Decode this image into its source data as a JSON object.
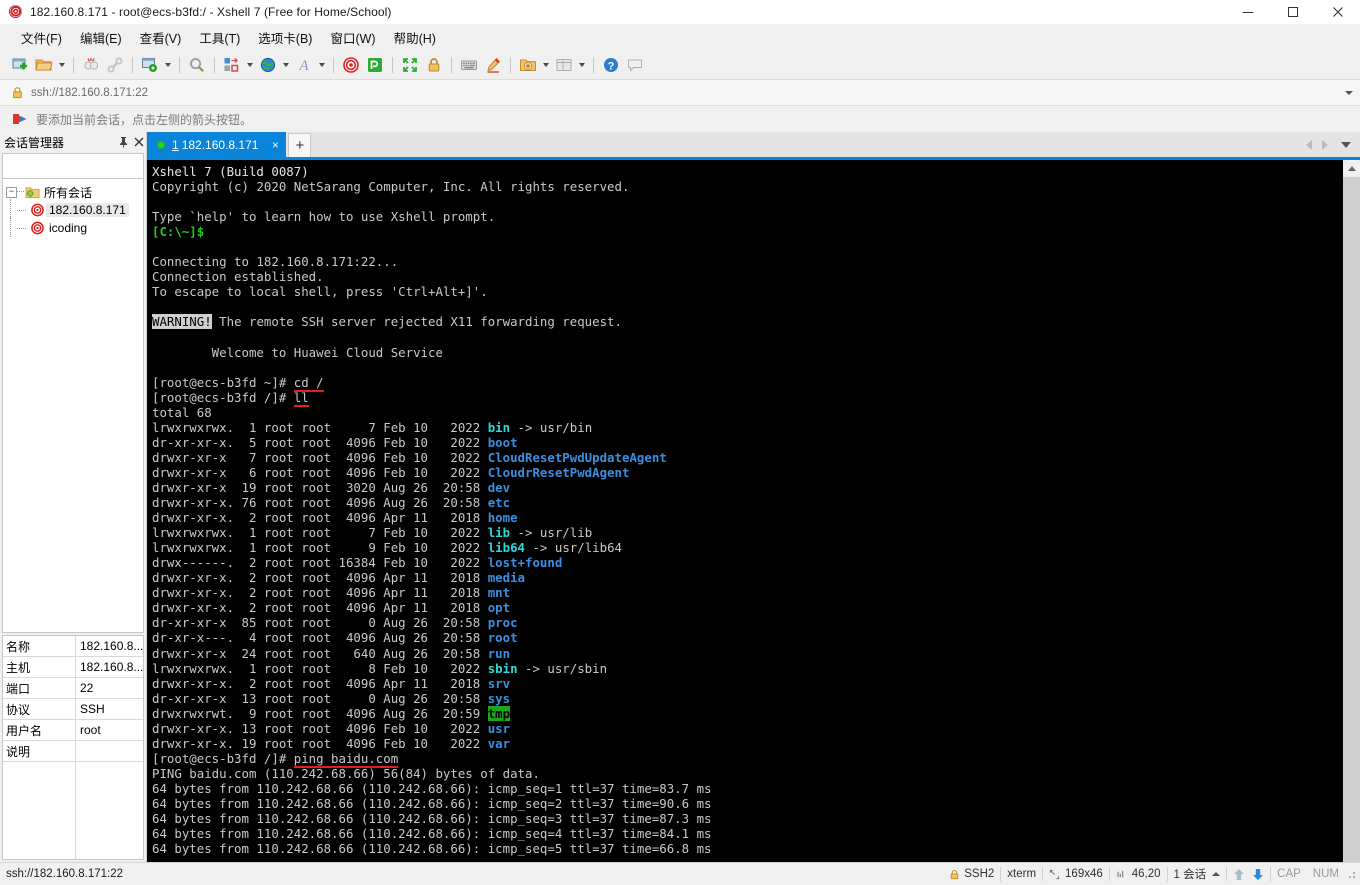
{
  "window": {
    "title": "182.160.8.171 - root@ecs-b3fd:/ - Xshell 7 (Free for Home/School)",
    "minimize": "minimize-button",
    "maximize": "maximize-button",
    "close": "close-button"
  },
  "menubar": [
    {
      "label": "文件(F)",
      "name": "menu-file"
    },
    {
      "label": "编辑(E)",
      "name": "menu-edit"
    },
    {
      "label": "查看(V)",
      "name": "menu-view"
    },
    {
      "label": "工具(T)",
      "name": "menu-tools"
    },
    {
      "label": "选项卡(B)",
      "name": "menu-tabs"
    },
    {
      "label": "窗口(W)",
      "name": "menu-window"
    },
    {
      "label": "帮助(H)",
      "name": "menu-help"
    }
  ],
  "toolbar": {
    "icons": [
      "new-session-icon",
      "open-folder-icon",
      "disconnect-icon",
      "link-icon",
      "session-properties-icon",
      "find-icon",
      "layout-icon",
      "globe-icon",
      "font-icon",
      "xshell-icon",
      "xftp-icon",
      "fullscreen-icon",
      "lock-icon",
      "keyboard-icon",
      "highlight-pen-icon",
      "add-to-folder-icon",
      "split-view-icon",
      "help-icon",
      "comment-icon"
    ]
  },
  "addressbar": {
    "value": "ssh://182.160.8.171:22",
    "lock": "lock-icon",
    "dropdown": "chevron-down-icon"
  },
  "notice": {
    "text": "要添加当前会话，点击左侧的箭头按钮。",
    "icon": "red-arrow-icon"
  },
  "session_manager": {
    "title": "会话管理器",
    "pin": "pin-icon",
    "close": "close-icon",
    "search_placeholder": "",
    "search_icon": "search-icon",
    "tree": {
      "root": {
        "label": "所有会话",
        "expander": "-"
      },
      "children": [
        {
          "label": "182.160.8.171",
          "selected": true
        },
        {
          "label": "icoding",
          "selected": false
        }
      ]
    },
    "properties": [
      {
        "key": "名称",
        "value": "182.160.8..."
      },
      {
        "key": "主机",
        "value": "182.160.8..."
      },
      {
        "key": "端口",
        "value": "22"
      },
      {
        "key": "协议",
        "value": "SSH"
      },
      {
        "key": "用户名",
        "value": "root"
      },
      {
        "key": "说明",
        "value": ""
      }
    ]
  },
  "tabs": {
    "items": [
      {
        "number": "1",
        "label": "182.160.8.171",
        "close": "×",
        "active": true
      }
    ],
    "new_tab": "+",
    "nav_prev": "prev-tab-arrow",
    "nav_next": "next-tab-arrow",
    "nav_list": "tab-list-chevron"
  },
  "terminal": {
    "banner": [
      "Xshell 7 (Build 0087)",
      "Copyright (c) 2020 NetSarang Computer, Inc. All rights reserved.",
      "",
      "Type `help' to learn how to use Xshell prompt."
    ],
    "local_prompt": "[C:\\~]$",
    "connect_lines": [
      "",
      "Connecting to 182.160.8.171:22...",
      "Connection established.",
      "To escape to local shell, press 'Ctrl+Alt+]'.",
      ""
    ],
    "warning_tag": "WARNING!",
    "warning_text": " The remote SSH server rejected X11 forwarding request.",
    "welcome": "        Welcome to Huawei Cloud Service",
    "prompt_home": "[root@ecs-b3fd ~]# ",
    "prompt_root": "[root@ecs-b3fd /]# ",
    "cmd_cd": "cd /",
    "cmd_ll": "ll",
    "cmd_ping": "ping baidu.com",
    "total_line": "total 68",
    "listing": [
      {
        "perm": "lrwxrwxrwx.",
        "links": " 1",
        "owner": "root root",
        "size": "    7",
        "date": "Feb 10",
        "time": " 2022",
        "name": "bin",
        "color": "cyan",
        "link": " -> usr/bin"
      },
      {
        "perm": "dr-xr-xr-x.",
        "links": " 5",
        "owner": "root root",
        "size": " 4096",
        "date": "Feb 10",
        "time": " 2022",
        "name": "boot",
        "color": "blue",
        "link": ""
      },
      {
        "perm": "drwxr-xr-x ",
        "links": " 7",
        "owner": "root root",
        "size": " 4096",
        "date": "Feb 10",
        "time": " 2022",
        "name": "CloudResetPwdUpdateAgent",
        "color": "blue",
        "link": ""
      },
      {
        "perm": "drwxr-xr-x ",
        "links": " 6",
        "owner": "root root",
        "size": " 4096",
        "date": "Feb 10",
        "time": " 2022",
        "name": "CloudrResetPwdAgent",
        "color": "blue",
        "link": ""
      },
      {
        "perm": "drwxr-xr-x ",
        "links": "19",
        "owner": "root root",
        "size": " 3020",
        "date": "Aug 26",
        "time": "20:58",
        "name": "dev",
        "color": "blue",
        "link": ""
      },
      {
        "perm": "drwxr-xr-x.",
        "links": "76",
        "owner": "root root",
        "size": " 4096",
        "date": "Aug 26",
        "time": "20:58",
        "name": "etc",
        "color": "blue",
        "link": ""
      },
      {
        "perm": "drwxr-xr-x.",
        "links": " 2",
        "owner": "root root",
        "size": " 4096",
        "date": "Apr 11",
        "time": " 2018",
        "name": "home",
        "color": "blue",
        "link": ""
      },
      {
        "perm": "lrwxrwxrwx.",
        "links": " 1",
        "owner": "root root",
        "size": "    7",
        "date": "Feb 10",
        "time": " 2022",
        "name": "lib",
        "color": "cyan",
        "link": " -> usr/lib"
      },
      {
        "perm": "lrwxrwxrwx.",
        "links": " 1",
        "owner": "root root",
        "size": "    9",
        "date": "Feb 10",
        "time": " 2022",
        "name": "lib64",
        "color": "cyan",
        "link": " -> usr/lib64"
      },
      {
        "perm": "drwx------.",
        "links": " 2",
        "owner": "root root",
        "size": "16384",
        "date": "Feb 10",
        "time": " 2022",
        "name": "lost+found",
        "color": "blue",
        "link": ""
      },
      {
        "perm": "drwxr-xr-x.",
        "links": " 2",
        "owner": "root root",
        "size": " 4096",
        "date": "Apr 11",
        "time": " 2018",
        "name": "media",
        "color": "blue",
        "link": ""
      },
      {
        "perm": "drwxr-xr-x.",
        "links": " 2",
        "owner": "root root",
        "size": " 4096",
        "date": "Apr 11",
        "time": " 2018",
        "name": "mnt",
        "color": "blue",
        "link": ""
      },
      {
        "perm": "drwxr-xr-x.",
        "links": " 2",
        "owner": "root root",
        "size": " 4096",
        "date": "Apr 11",
        "time": " 2018",
        "name": "opt",
        "color": "blue",
        "link": ""
      },
      {
        "perm": "dr-xr-xr-x ",
        "links": "85",
        "owner": "root root",
        "size": "    0",
        "date": "Aug 26",
        "time": "20:58",
        "name": "proc",
        "color": "blue",
        "link": ""
      },
      {
        "perm": "dr-xr-x---.",
        "links": " 4",
        "owner": "root root",
        "size": " 4096",
        "date": "Aug 26",
        "time": "20:58",
        "name": "root",
        "color": "blue",
        "link": ""
      },
      {
        "perm": "drwxr-xr-x ",
        "links": "24",
        "owner": "root root",
        "size": "  640",
        "date": "Aug 26",
        "time": "20:58",
        "name": "run",
        "color": "blue",
        "link": ""
      },
      {
        "perm": "lrwxrwxrwx.",
        "links": " 1",
        "owner": "root root",
        "size": "    8",
        "date": "Feb 10",
        "time": " 2022",
        "name": "sbin",
        "color": "cyan",
        "link": " -> usr/sbin"
      },
      {
        "perm": "drwxr-xr-x.",
        "links": " 2",
        "owner": "root root",
        "size": " 4096",
        "date": "Apr 11",
        "time": " 2018",
        "name": "srv",
        "color": "blue",
        "link": ""
      },
      {
        "perm": "dr-xr-xr-x ",
        "links": "13",
        "owner": "root root",
        "size": "    0",
        "date": "Aug 26",
        "time": "20:58",
        "name": "sys",
        "color": "blue",
        "link": ""
      },
      {
        "perm": "drwxrwxrwt.",
        "links": " 9",
        "owner": "root root",
        "size": " 4096",
        "date": "Aug 26",
        "time": "20:59",
        "name": "tmp",
        "color": "tmp",
        "link": ""
      },
      {
        "perm": "drwxr-xr-x.",
        "links": "13",
        "owner": "root root",
        "size": " 4096",
        "date": "Feb 10",
        "time": " 2022",
        "name": "usr",
        "color": "blue",
        "link": ""
      },
      {
        "perm": "drwxr-xr-x.",
        "links": "19",
        "owner": "root root",
        "size": " 4096",
        "date": "Feb 10",
        "time": " 2022",
        "name": "var",
        "color": "blue",
        "link": ""
      }
    ],
    "ping_header": "PING baidu.com (110.242.68.66) 56(84) bytes of data.",
    "ping_replies": [
      "64 bytes from 110.242.68.66 (110.242.68.66): icmp_seq=1 ttl=37 time=83.7 ms",
      "64 bytes from 110.242.68.66 (110.242.68.66): icmp_seq=2 ttl=37 time=90.6 ms",
      "64 bytes from 110.242.68.66 (110.242.68.66): icmp_seq=3 ttl=37 time=87.3 ms",
      "64 bytes from 110.242.68.66 (110.242.68.66): icmp_seq=4 ttl=37 time=84.1 ms",
      "64 bytes from 110.242.68.66 (110.242.68.66): icmp_seq=5 ttl=37 time=66.8 ms"
    ],
    "colors": {
      "background": "#000000",
      "foreground": "#d8d8d8",
      "directory": "#3b8fe0",
      "symlink": "#2bd8d8",
      "prompt_green": "#1fd01f",
      "tmp_bg": "#1aa81a",
      "underline_red": "#e02020"
    }
  },
  "statusbar": {
    "url": "ssh://182.160.8.171:22",
    "protocol": "SSH2",
    "protocol_icon": "lock-icon",
    "terminal_type": "xterm",
    "size_icon": "resize-icon",
    "size": "169x46",
    "cursor_icon": "cursor-icon",
    "cursor": "46,20",
    "sessions": "1 会话",
    "sessions_caret": "chevron-up-icon",
    "upload_icon": "upload-arrow-icon",
    "download_icon": "download-arrow-icon",
    "cap": "CAP",
    "num": "NUM"
  }
}
